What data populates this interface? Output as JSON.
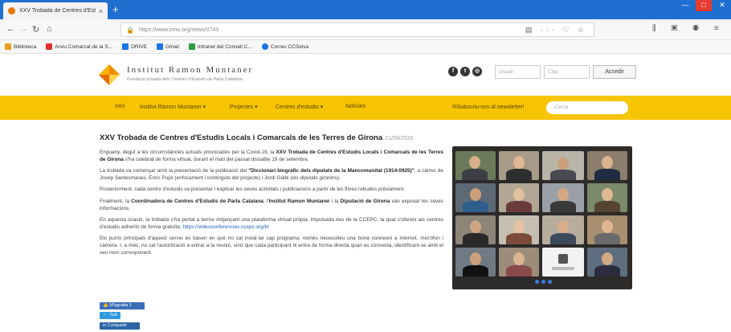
{
  "browser": {
    "tab_title": "XXV Trobada de Centres d'Est...",
    "tab_close": "×",
    "new_tab": "+",
    "url": "https://www.irmu.org/news/0743",
    "bookmarks": [
      {
        "label": "Biblioteca",
        "color": "#e8a020"
      },
      {
        "label": "Arxiu Comarcal de la S...",
        "color": "#d33"
      },
      {
        "label": "DRIVE",
        "color": "#1a73e8"
      },
      {
        "label": "Gmail",
        "color": "#1a73e8"
      },
      {
        "label": "Intranet del Consell C...",
        "color": "#2a9d3b"
      },
      {
        "label": "Correu CCSelva",
        "color": "#1a73e8"
      }
    ]
  },
  "site": {
    "brand_name": "Institut Ramon Muntaner",
    "brand_tagline": "Fundació privada dels Centres d'Estudis de Parla Catalana",
    "login_user_placeholder": "Usuari",
    "login_pass_placeholder": "Clau",
    "login_button": "Accedir",
    "menu": [
      {
        "label": "Inici",
        "x": 0
      },
      {
        "label": "Institut Ramon Muntaner ▾"
      },
      {
        "label": "Projectes ▾"
      },
      {
        "label": "Centres d'estudis ▾"
      },
      {
        "label": "Notícies"
      }
    ],
    "subscribe": "✉Subscriu-vos al newsletter!",
    "search_placeholder": "Cerca"
  },
  "article": {
    "title": "XXV Trobada de Centres d'Estudis Locals i Comarcals de les Terres de Girona",
    "date": "21/09/2020",
    "p1_a": "Enguany, degut a les circumstàncies actuals provocades per la Covid-19, la ",
    "p1_b": "XXV Trobada de Centres d'Estudis Locals i Comarcals de les Terres de Girona",
    "p1_c": " s'ha celebrat de forma virtual, durant el matí del passat dissabte 19 de setembre.",
    "p2_a": "La trobada va començar amb la presentació de la publicació del ",
    "p2_b": "\"Diccionari biogràfic dels diputats de la Mancomunitat (1914-0925)\"",
    "p2_c": ", a càrrec de Josep Santesmases, Enric Pujol (enfocament i continguts del projecte) i Jordi Galbi (els diputats gironins).",
    "p3": "Posteriorment, cada centre d'estudis va presentar i explicar les seves activitats i publicacions a partir de les fitxes rebudes prèviament.",
    "p4_a": "Finalment, la ",
    "p4_b": "Coordinadora de Centres d'Estudis de Parla Catalana",
    "p4_c": ", l'",
    "p4_d": "Institut Ramon Muntaner",
    "p4_e": " i la ",
    "p4_f": "Diputació de Girona",
    "p4_g": " van exposar les seves informacions.",
    "p5_a": "En aquesta ocasió, la trobada s'ha portat a terme mitjançant una plataforma virtual pròpia, impulsada des de la CCEPC, la qual s'ofereix als centres d'estudis adherits de forma gratuïta: ",
    "p5_link": "https://videoconferencies.ccepc.org/b/",
    "p6": "Els punts principals d'aquest servei es basen en què no cal instal·lar cap programa, només necessiteu una bona connexió a internet, micròfon i càmera. I, a més, no cal l'autorització a entrar a la reunió, sinó que cada participant hi entra de forma directa quan es connecta, identificant-se amb el seu nom corresponent."
  },
  "share": {
    "facebook": "👍 M'agrada 1",
    "twitter": "🐦 Tuit",
    "linkedin": "in Compartir"
  },
  "colors": {
    "menu_bar": "#f6c400",
    "browser_titlebar": "#1f6fd0",
    "link": "#1a5fb4"
  }
}
